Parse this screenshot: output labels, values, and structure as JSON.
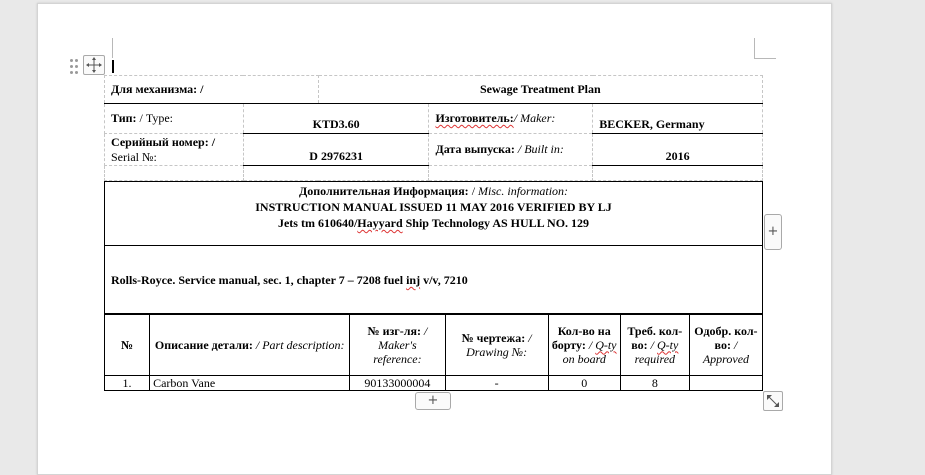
{
  "header_table": {
    "mechanism_label": "Для механизма: /",
    "mechanism_value": "Sewage Treatment Plan",
    "type_label_ru": "Тип:",
    "type_label_en": " / Type:",
    "type_value": "KTD3.60",
    "maker_label_ru": "Изготовитель:",
    "maker_label_en": "/ Maker:",
    "maker_value": "BECKER, Germany",
    "serial_label_ru": "Серийный номер: /",
    "serial_label_en": "Serial №:",
    "serial_value": "D 2976231",
    "built_label_ru": "Дата выпуска:",
    "built_label_en": " / Built in:",
    "built_value": "2016"
  },
  "misc_info": {
    "label_ru": "Дополнительная Информация:",
    "label_sep": " / ",
    "label_en": "Misc. information:",
    "line1": "INSTRUCTION MANUAL ISSUED 11 MAY 2016 VERIFIED BY LJ",
    "line2_a": "Jets tm 610640/",
    "line2_b": "Hayyard",
    "line2_c": " Ship Technology AS HULL NO. 129",
    "service_a": "Rolls-Royce. Service manual, sec. 1, chapter 7 – 7208 fuel ",
    "service_b": "inj",
    "service_c": " v/v, 7210"
  },
  "parts_table": {
    "headers": {
      "no": "№",
      "desc_ru": "Описание детали:",
      "desc_en": " / Part description:",
      "ref_ru": "№ изг-ля:",
      "ref_en": " / Maker's reference:",
      "drawing_ru": "№ чертежа:",
      "drawing_en": " / Drawing №:",
      "onboard_ru": "Кол-во на борту:",
      "onboard_en_a": " / ",
      "onboard_en_b": "Q-ty",
      "onboard_en_c": " on board",
      "required_ru": "Треб. кол-во:",
      "required_en_a": " / ",
      "required_en_b": "Q-ty",
      "required_en_c": " required",
      "approved_ru": "Одобр. кол-во:",
      "approved_en": " / Approved"
    },
    "rows": [
      {
        "no": "1.",
        "description": "Carbon Vane",
        "reference": "90133000004",
        "drawing": "-",
        "onboard": "0",
        "required": "8",
        "approved": ""
      }
    ]
  },
  "controls": {
    "add_row_symbol": "+",
    "add_column_symbol": "+"
  }
}
